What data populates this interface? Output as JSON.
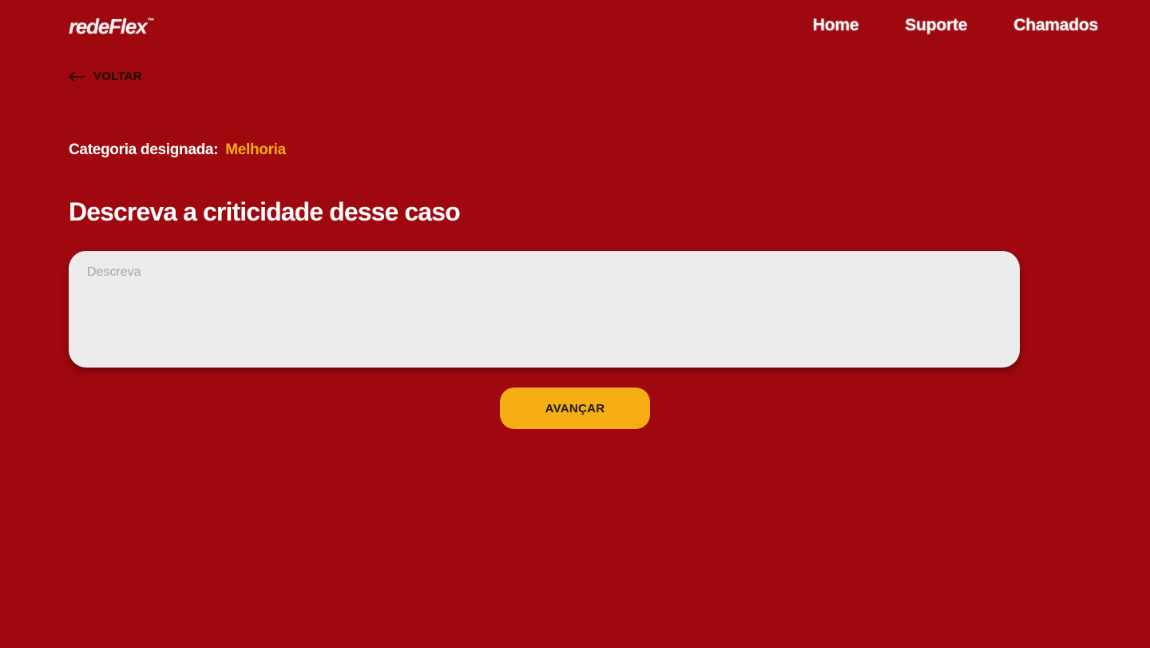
{
  "header": {
    "logo_text": "redeFlex",
    "logo_mark": "™",
    "nav": [
      {
        "label": "Home"
      },
      {
        "label": "Suporte"
      },
      {
        "label": "Chamados"
      }
    ]
  },
  "back": {
    "icon": "arrow-left-icon",
    "label": "VOLTAR"
  },
  "category": {
    "label": "Categoria designada:",
    "value": "Melhoria"
  },
  "title": "Descreva a criticidade desse caso",
  "description": {
    "placeholder": "Descreva",
    "value": ""
  },
  "submit_label": "AVANÇAR",
  "colors": {
    "background": "#9e080e",
    "accent": "#f6ae14",
    "input_bg": "#ececec",
    "text_light": "#ffffff",
    "text_dark": "#1a0b0b"
  }
}
